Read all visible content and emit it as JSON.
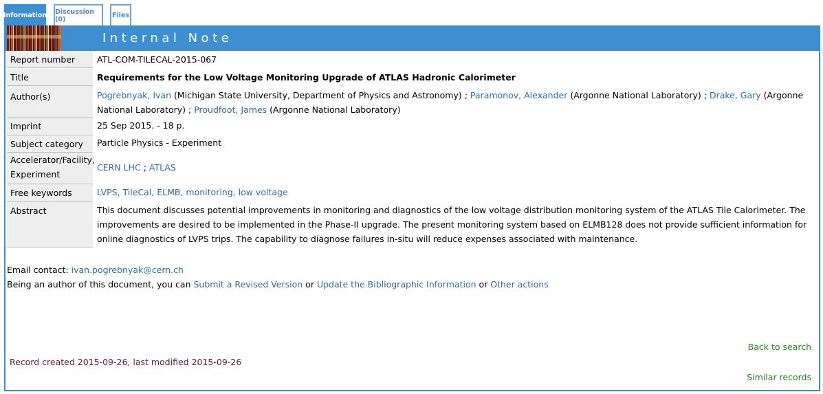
{
  "tabs": [
    {
      "label": "Information",
      "active": true
    },
    {
      "label": "Discussion (0)",
      "active": false
    },
    {
      "label": "Files",
      "active": false
    }
  ],
  "banner": {
    "title": "Internal Note"
  },
  "fields": {
    "report_number": {
      "label": "Report number",
      "value": "ATL-COM-TILECAL-2015-067"
    },
    "title": {
      "label": "Title",
      "value": "Requirements for the Low Voltage Monitoring Upgrade of ATLAS Hadronic Calorimeter"
    },
    "authors": {
      "label": "Author(s)",
      "list": [
        {
          "name": "Pogrebnyak, Ivan",
          "affiliation": " (Michigan State University, Department of Physics and Astronomy) ; "
        },
        {
          "name": "Paramonov, Alexander",
          "affiliation": " (Argonne National Laboratory) ; "
        },
        {
          "name": "Drake, Gary",
          "affiliation": " (Argonne National Laboratory) ; "
        },
        {
          "name": "Proudfoot, James",
          "affiliation": " (Argonne National Laboratory)"
        }
      ]
    },
    "imprint": {
      "label": "Imprint",
      "value": "25 Sep 2015. - 18 p."
    },
    "subject_category": {
      "label": "Subject category",
      "value": "Particle Physics - Experiment"
    },
    "accelerator": {
      "label": "Accelerator/Facility, Experiment",
      "link1": "CERN LHC",
      "sep": " ; ",
      "link2": "ATLAS"
    },
    "free_keywords": {
      "label": "Free keywords",
      "value": "LVPS, TileCal, ELMB, monitoring, low voltage"
    },
    "abstract": {
      "label": "Abstract",
      "value": "This document discusses potential improvements in monitoring and diagnostics of the low voltage distribution monitoring system of the ATLAS Tile Calorimeter. The improvements are desired to be implemented in the Phase-II upgrade. The present monitoring system based on ELMB128 does not provide sufficient information for online diagnostics of LVPS trips. The capability to diagnose failures in-situ will reduce expenses associated with maintenance."
    }
  },
  "contact": {
    "email_label": "Email contact: ",
    "email": "ivan.pogrebnyak@cern.ch",
    "author_text": "Being an author of this document, you can ",
    "submit_revised": "Submit a Revised Version",
    "or1": " or ",
    "update_biblio": "Update the Bibliographic Information",
    "or2": " or ",
    "other_actions": "Other actions"
  },
  "footer": {
    "back_to_search": "Back to search",
    "record_created": "Record created 2015-09-26, last modified 2015-09-26",
    "similar_records": "Similar records"
  },
  "colors": {
    "accent": "#3d8fd1",
    "link": "#2e6da4",
    "footer_link": "#2e7d2e",
    "record_text": "#6a1a2e",
    "label_bg": "#eeeeee"
  }
}
